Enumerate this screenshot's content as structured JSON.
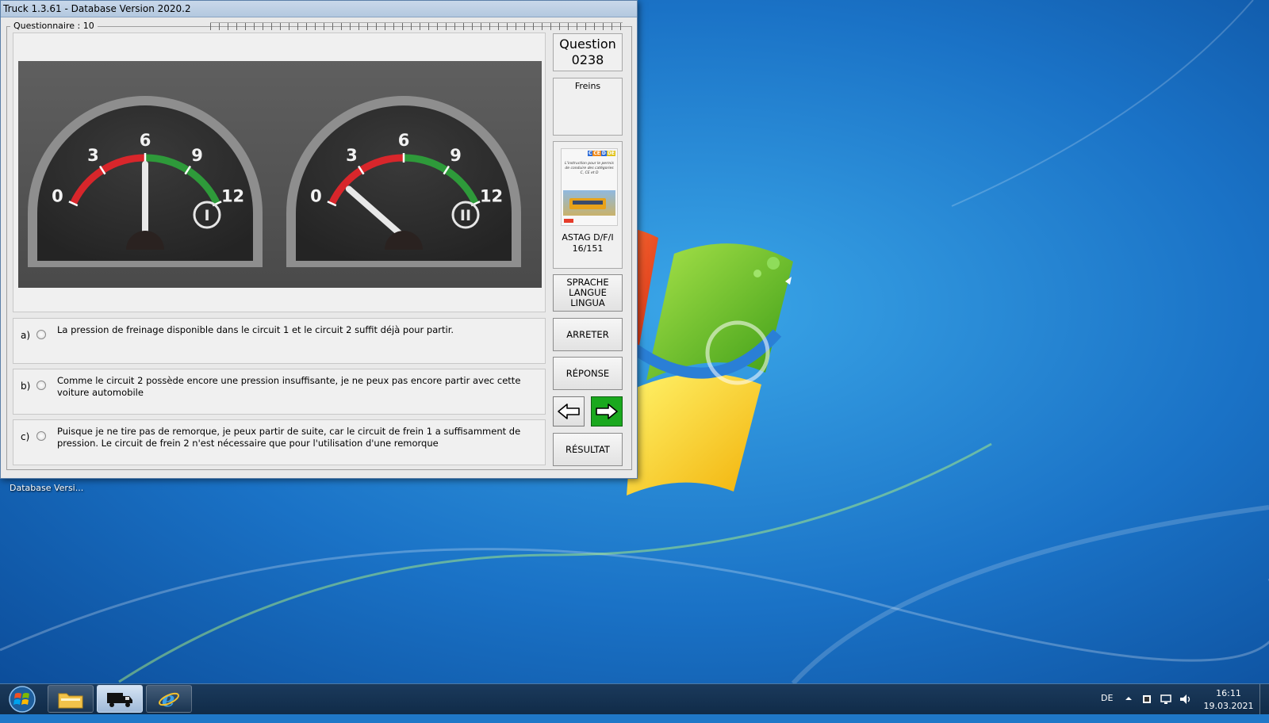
{
  "window": {
    "title": "Truck 1.3.61 - Database Version 2020.2",
    "questionnaire_label": "Questionnaire : 10"
  },
  "question": {
    "header": "Question",
    "number": "0238",
    "category": "Freins",
    "gauges": [
      {
        "marks": [
          "0",
          "3",
          "6",
          "9",
          "12"
        ],
        "circuit_symbol": "I",
        "needle_value": 6
      },
      {
        "marks": [
          "0",
          "3",
          "6",
          "9",
          "12"
        ],
        "circuit_symbol": "II",
        "needle_value": 1.5
      }
    ],
    "book": {
      "cover_tags": [
        "C",
        "CE",
        "D",
        "DE"
      ],
      "cover_text": "L'instruction pour le permis de conduire des catégories C, CE et D",
      "label_line1": "ASTAG D/F/I",
      "label_line2": "16/151"
    }
  },
  "answers": [
    {
      "letter": "a)",
      "text": "La pression de freinage disponible dans le circuit 1 et le circuit 2 suffit déjà pour partir."
    },
    {
      "letter": "b)",
      "text": "Comme le circuit 2 possède encore une pression insuffisante, je ne peux pas encore partir avec cette voiture automobile"
    },
    {
      "letter": "c)",
      "text": "Puisque je ne tire pas de remorque, je peux partir de suite, car le circuit de frein 1 a suffisamment de pression. Le circuit de frein 2 n'est nécessaire que pour l'utilisation d'une remorque"
    }
  ],
  "buttons": {
    "language": [
      "SPRACHE",
      "LANGUE",
      "LINGUA"
    ],
    "stop": "ARRETER",
    "answer": "RÉPONSE",
    "result": "RÉSULTAT"
  },
  "desktop": {
    "minimized_label": "Database Versi..."
  },
  "taskbar": {
    "language": "DE",
    "time": "16:11",
    "date": "19.03.2021"
  },
  "colors": {
    "gauge_red": "#d8262b",
    "gauge_green": "#2e9a3a",
    "next_button": "#1aa81e",
    "desktop_blue": "#1f78c8"
  }
}
